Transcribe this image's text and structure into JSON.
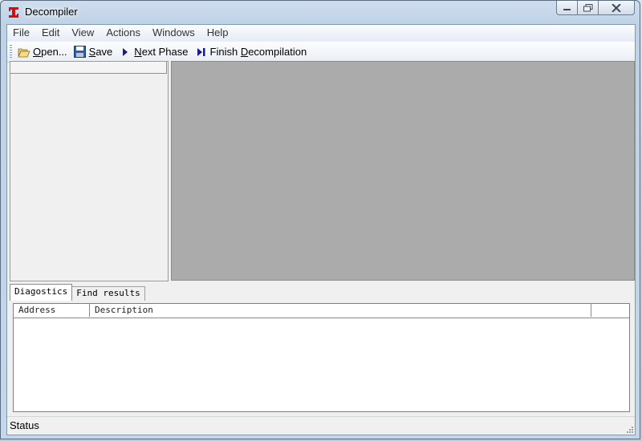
{
  "window": {
    "title": "Decompiler"
  },
  "menu": {
    "items": [
      "File",
      "Edit",
      "View",
      "Actions",
      "Windows",
      "Help"
    ]
  },
  "toolbar": {
    "open": {
      "pre": "",
      "key": "O",
      "post": "pen..."
    },
    "save": {
      "pre": "",
      "key": "S",
      "post": "ave"
    },
    "next_phase": {
      "pre": "",
      "key": "N",
      "post": "ext Phase"
    },
    "finish": {
      "pre": "Finish ",
      "key": "D",
      "post": "ecompilation"
    }
  },
  "tabs": [
    "Diagostics",
    "Find results"
  ],
  "diagnostics": {
    "columns": [
      "Address",
      "Description",
      ""
    ],
    "rows": []
  },
  "status": {
    "text": "Status"
  },
  "colors": {
    "mdi_background": "#ababab",
    "accent_icon": "#1a1a8c",
    "app_icon": "#d01010"
  },
  "icons": {
    "app": "app-logo-icon",
    "open": "folder-open-icon",
    "save": "floppy-disk-icon",
    "next": "play-arrow-icon",
    "finish": "skip-to-end-icon"
  }
}
